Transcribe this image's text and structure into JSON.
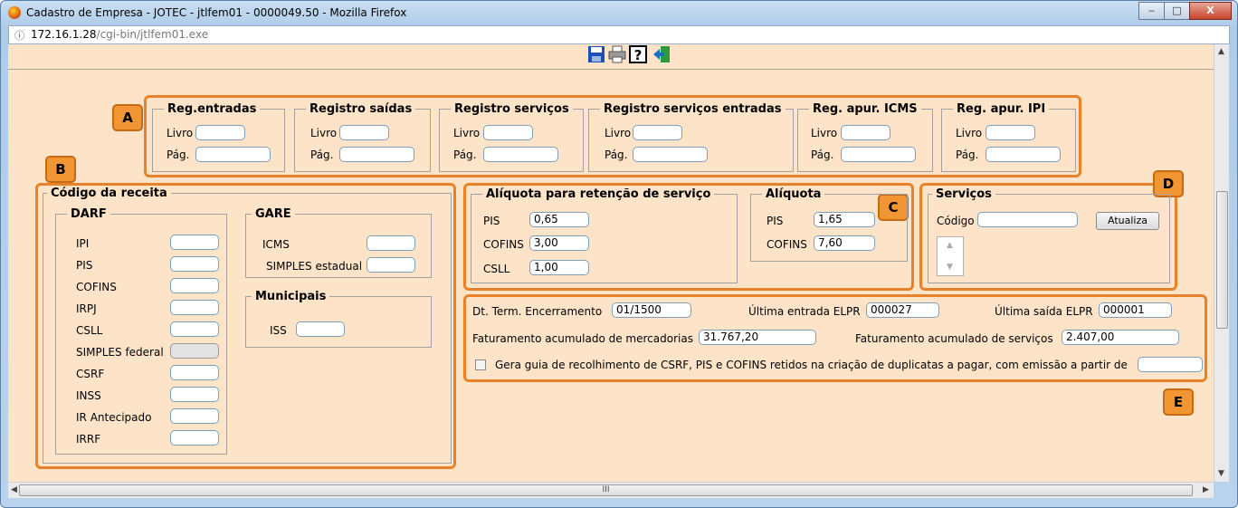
{
  "window": {
    "title": "Cadastro de Empresa - JOTEC - jtlfem01 - 0000049.50 - Mozilla Firefox",
    "min": "‒",
    "max": "□",
    "close": "X"
  },
  "url": {
    "host": "172.16.1.28",
    "path": "/cgi-bin/jtlfem01.exe",
    "info": "ⓘ"
  },
  "badges": {
    "a": "A",
    "b": "B",
    "c": "C",
    "d": "D",
    "e": "E"
  },
  "registros": {
    "livro_label": "Livro",
    "pag_label": "Pág.",
    "groups": [
      {
        "title": "Reg.entradas"
      },
      {
        "title": "Registro saídas"
      },
      {
        "title": "Registro serviços"
      },
      {
        "title": "Registro serviços entradas"
      },
      {
        "title": "Reg. apur. ICMS"
      },
      {
        "title": "Reg. apur. IPI"
      }
    ]
  },
  "codigo_receita": {
    "title": "Código da receita",
    "darf": {
      "title": "DARF",
      "items": [
        "IPI",
        "PIS",
        "COFINS",
        "IRPJ",
        "CSLL",
        "SIMPLES federal",
        "CSRF",
        "INSS",
        "IR Antecipado",
        "IRRF"
      ]
    },
    "gare": {
      "title": "GARE",
      "items": [
        "ICMS",
        "SIMPLES estadual"
      ]
    },
    "municipais": {
      "title": "Municipais",
      "items": [
        "ISS"
      ]
    }
  },
  "aliquota_retencao": {
    "title": "Alíquota para retenção de serviço",
    "pis_label": "PIS",
    "pis": "0,65",
    "cofins_label": "COFINS",
    "cofins": "3,00",
    "csll_label": "CSLL",
    "csll": "1,00"
  },
  "aliquota": {
    "title": "Alíquota",
    "pis_label": "PIS",
    "pis": "1,65",
    "cofins_label": "COFINS",
    "cofins": "7,60"
  },
  "servicos": {
    "title": "Serviços",
    "codigo_label": "Código",
    "codigo": "",
    "atualiza": "Atualiza"
  },
  "info": {
    "dt_term_label": "Dt. Term. Encerramento",
    "dt_term": "01/1500",
    "ult_entrada_label": "Última entrada ELPR",
    "ult_entrada": "000027",
    "ult_saida_label": "Última saída ELPR",
    "ult_saida": "000001",
    "fat_merc_label": "Faturamento acumulado de mercadorias",
    "fat_merc": "31.767,20",
    "fat_serv_label": "Faturamento acumulado de serviços",
    "fat_serv": "2.407,00",
    "gera_guia_label": "Gera guia de recolhimento de CSRF, PIS e COFINS retidos na criação de duplicatas a pagar, com emissão a partir de",
    "gera_guia_date": ""
  },
  "scroll": {
    "h_grip": "III",
    "up": "▲",
    "down": "▼",
    "left": "◀",
    "right": "▶"
  },
  "colors": {
    "page_bg": "#fde4c8",
    "highlight": "#e8822a",
    "badge": "#f29533"
  }
}
